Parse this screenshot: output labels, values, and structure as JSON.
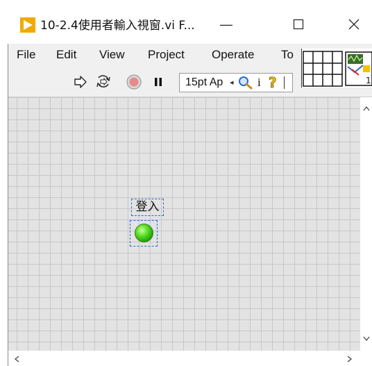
{
  "window": {
    "title": "10-2.4使用者輸入視窗.vi F...",
    "minimize_glyph": "—",
    "maximize_glyph": "☐",
    "close_glyph": "✕"
  },
  "menu": {
    "items": [
      "File",
      "Edit",
      "View",
      "Project",
      "Operate",
      "To"
    ]
  },
  "toolbar": {
    "font_label": "15pt Ap",
    "icons": [
      "run-arrow-icon",
      "run-continuously-icon",
      "abort-icon",
      "pause-icon",
      "search-icon",
      "info-icon",
      "help-icon"
    ]
  },
  "front_panel": {
    "led_label": "登入",
    "led_state": "on",
    "led_color": "#4cd21a"
  },
  "colors": {
    "app_icon": "#f2a900",
    "grid_bg": "#e3e3e3",
    "selection": "#2a6ac7"
  }
}
